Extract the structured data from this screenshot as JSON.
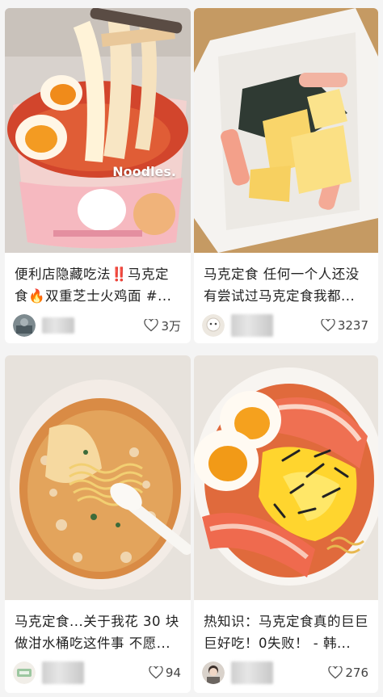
{
  "feed": {
    "cards": [
      {
        "title": "便利店隐藏吃法‼️马克定食🔥双重芝士火鸡面 #...",
        "likes": "3万",
        "image_label": "Noodles."
      },
      {
        "title": "马克定食 任何一个人还没有尝试过马克定食我都...",
        "likes": "3237"
      },
      {
        "title": "马克定食...关于我花 30 块做泔水桶吃这件事 不愿...",
        "likes": "94"
      },
      {
        "title": "热知识：马克定食真的巨巨巨好吃！0失败！ - 韩...",
        "likes": "276"
      }
    ],
    "icons": {
      "like": "heart-outline-icon"
    }
  }
}
